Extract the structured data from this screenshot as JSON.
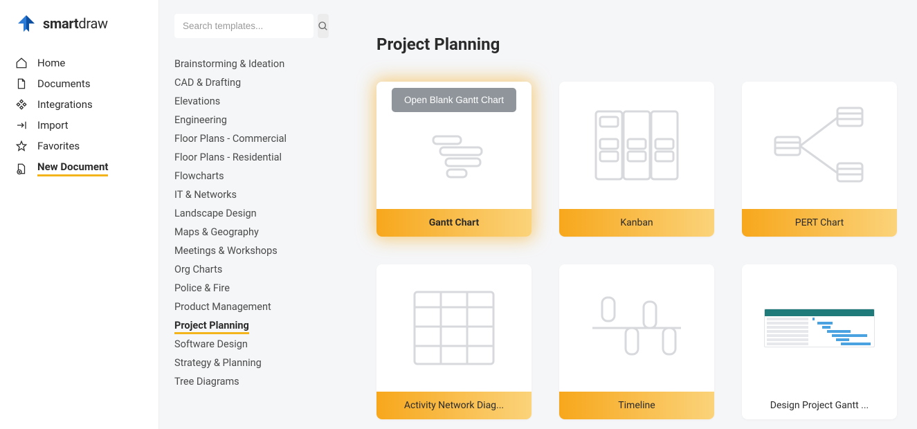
{
  "logo": {
    "bold_prefix": "smart",
    "rest": "draw"
  },
  "nav": {
    "items": [
      {
        "label": "Home",
        "icon": "home",
        "active": false
      },
      {
        "label": "Documents",
        "icon": "document",
        "active": false
      },
      {
        "label": "Integrations",
        "icon": "integration",
        "active": false
      },
      {
        "label": "Import",
        "icon": "import",
        "active": false
      },
      {
        "label": "Favorites",
        "icon": "star",
        "active": false
      },
      {
        "label": "New Document",
        "icon": "new-doc",
        "active": true
      }
    ]
  },
  "search": {
    "placeholder": "Search templates..."
  },
  "categories": [
    {
      "label": "Brainstorming & Ideation",
      "active": false
    },
    {
      "label": "CAD & Drafting",
      "active": false
    },
    {
      "label": "Elevations",
      "active": false
    },
    {
      "label": "Engineering",
      "active": false
    },
    {
      "label": "Floor Plans - Commercial",
      "active": false
    },
    {
      "label": "Floor Plans - Residential",
      "active": false
    },
    {
      "label": "Flowcharts",
      "active": false
    },
    {
      "label": "IT & Networks",
      "active": false
    },
    {
      "label": "Landscape Design",
      "active": false
    },
    {
      "label": "Maps & Geography",
      "active": false
    },
    {
      "label": "Meetings & Workshops",
      "active": false
    },
    {
      "label": "Org Charts",
      "active": false
    },
    {
      "label": "Police & Fire",
      "active": false
    },
    {
      "label": "Product Management",
      "active": false
    },
    {
      "label": "Project Planning",
      "active": true
    },
    {
      "label": "Software Design",
      "active": false
    },
    {
      "label": "Strategy & Planning",
      "active": false
    },
    {
      "label": "Tree Diagrams",
      "active": false
    }
  ],
  "page": {
    "title": "Project Planning",
    "open_blank_label": "Open Blank Gantt Chart"
  },
  "templates": [
    {
      "label": "Gantt Chart",
      "highlighted": true,
      "gradient": true,
      "thumb": "gantt"
    },
    {
      "label": "Kanban",
      "highlighted": false,
      "gradient": true,
      "thumb": "kanban"
    },
    {
      "label": "PERT Chart",
      "highlighted": false,
      "gradient": true,
      "thumb": "pert"
    },
    {
      "label": "Activity Network Diag...",
      "highlighted": false,
      "gradient": true,
      "thumb": "grid"
    },
    {
      "label": "Timeline",
      "highlighted": false,
      "gradient": true,
      "thumb": "timeline"
    },
    {
      "label": "Design Project Gantt ...",
      "highlighted": false,
      "gradient": false,
      "thumb": "image"
    }
  ]
}
